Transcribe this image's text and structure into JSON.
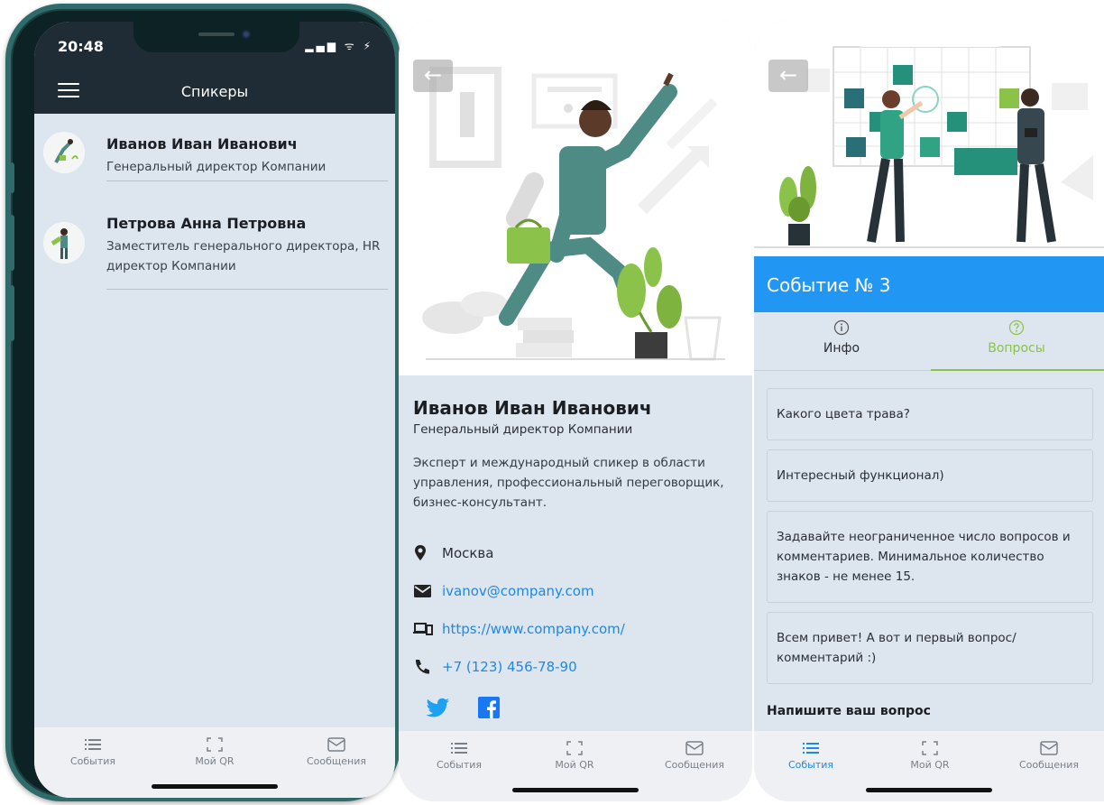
{
  "phone1": {
    "status_time": "20:48",
    "status_icons": "▂▄▆ ᯤ ⚡",
    "title": "Спикеры",
    "speakers": [
      {
        "name": "Иванов Иван Иванович",
        "role": "Генеральный директор Компании"
      },
      {
        "name": "Петрова Анна Петровна",
        "role": "Заместитель генерального директора, HR директор Компании"
      }
    ]
  },
  "nav": {
    "events": "События",
    "qr": "Мой QR",
    "messages": "Сообщения"
  },
  "phone2": {
    "name": "Иванов Иван Иванович",
    "role": "Генеральный директор Компании",
    "bio": "Эксперт и международный спикер в области управления, профессиональный переговорщик, бизнес-консультант.",
    "city": "Москва",
    "email": "ivanov@company.com",
    "website": "https://www.company.com/",
    "phone": "+7 (123) 456-78-90",
    "back_icon": "←",
    "social": [
      "twitter-icon",
      "facebook-icon"
    ]
  },
  "phone3": {
    "event_title": "Событие № 3",
    "tabs": [
      "Инфо",
      "Вопросы"
    ],
    "questions": [
      "Какого цвета трава?",
      "Интересный функционал)",
      "Задавайте неограниченное число вопросов и комментариев. Минимальное количество знаков - не менее 15.",
      "Всем привет! А вот и первый вопрос/ комментарий :)"
    ],
    "ask_label": "Напишите ваш вопрос",
    "back_icon": "←"
  },
  "colors": {
    "accent": "#2196f3",
    "green": "#8bc34a",
    "dark_bar": "#1f2b35",
    "background": "#dde5ef",
    "link": "#1e88e5"
  }
}
